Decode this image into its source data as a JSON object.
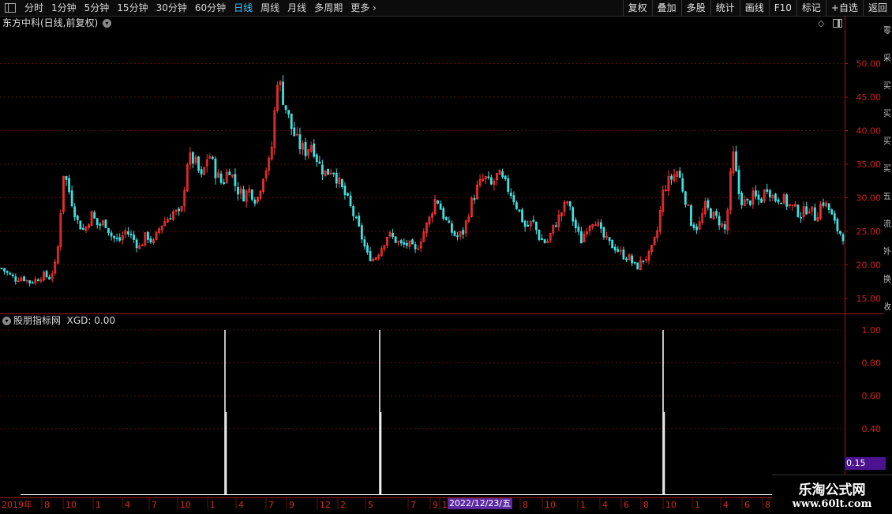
{
  "toolbar": {
    "periods": [
      "分时",
      "1分钟",
      "5分钟",
      "15分钟",
      "30分钟",
      "60分钟",
      "日线",
      "周线",
      "月线",
      "多周期",
      "更多"
    ],
    "active_period": "日线",
    "right_buttons": [
      "复权",
      "叠加",
      "多股",
      "统计",
      "画线",
      "F10",
      "标记",
      "+自选",
      "返回"
    ]
  },
  "main_chart": {
    "title": "东方中科(日线,前复权)",
    "price_ticks": [
      "50.00",
      "45.00",
      "40.00",
      "35.00",
      "30.00",
      "25.00",
      "20.00",
      "15.00"
    ]
  },
  "indicator": {
    "title": "股朋指标网",
    "value_label": "XGD: 0.00",
    "ticks": [
      "1.00",
      "0.80",
      "0.60",
      "0.40"
    ],
    "current_value": "0.15"
  },
  "x_axis": {
    "labels": [
      "2019年",
      "8",
      "10",
      "1",
      "4",
      "7",
      "10",
      "1",
      "4",
      "7",
      "9",
      "12",
      "2",
      "5",
      "7",
      "9",
      "1",
      "2022/12/23/五",
      "8",
      "10",
      "1",
      "4",
      "6",
      "8",
      "10",
      "1",
      "4",
      "6",
      "8"
    ],
    "cursor_date": "2022/12/23/五"
  },
  "watermark": {
    "name": "乐淘公式网",
    "url": "www.60lt.com"
  },
  "colors": {
    "up": "#ff3333",
    "down": "#40e0e0",
    "active": "#36c8ff",
    "axis_line": "#a01818",
    "grid": "#5a1010"
  },
  "chart_data": {
    "type": "candlestick",
    "ylim": [
      13,
      55
    ],
    "closes": [
      19.5,
      18.6,
      17.9,
      18.2,
      17.4,
      17.8,
      18.5,
      18.1,
      20.5,
      34.0,
      30.2,
      26.5,
      25.0,
      27.6,
      25.8,
      26.4,
      24.2,
      23.5,
      25.1,
      24.0,
      22.6,
      24.5,
      23.2,
      25.8,
      26.9,
      28.0,
      27.2,
      36.0,
      35.5,
      32.8,
      36.8,
      33.9,
      32.0,
      34.6,
      31.5,
      30.3,
      31.2,
      29.5,
      33.8,
      35.5,
      48.0,
      44.2,
      40.5,
      38.0,
      36.9,
      38.2,
      35.0,
      33.6,
      34.5,
      32.0,
      30.0,
      27.5,
      24.8,
      21.5,
      20.8,
      22.5,
      24.6,
      23.8,
      22.9,
      23.1,
      22.0,
      24.5,
      26.8,
      30.2,
      27.5,
      25.3,
      24.1,
      25.0,
      29.0,
      31.5,
      33.0,
      31.8,
      33.5,
      32.0,
      30.5,
      28.0,
      25.5,
      26.5,
      24.0,
      23.2,
      25.5,
      27.5,
      29.5,
      26.2,
      23.5,
      26.0,
      27.0,
      24.5,
      23.2,
      22.6,
      21.5,
      21.0,
      19.5,
      20.8,
      21.5,
      24.6,
      31.5,
      32.8,
      34.0,
      30.5,
      26.3,
      25.5,
      28.7,
      27.5,
      26.6,
      25.0,
      36.8,
      30.0,
      29.0,
      30.2,
      29.5,
      31.8,
      29.8,
      30.1,
      29.0,
      28.3,
      27.5,
      28.8,
      27.0,
      29.6,
      28.2,
      25.5,
      24.3
    ],
    "signal": {
      "x_positions": [
        "late 2020",
        "mid 2021",
        "Oct 2022"
      ],
      "values": [
        1.0,
        1.0,
        1.0
      ]
    }
  }
}
